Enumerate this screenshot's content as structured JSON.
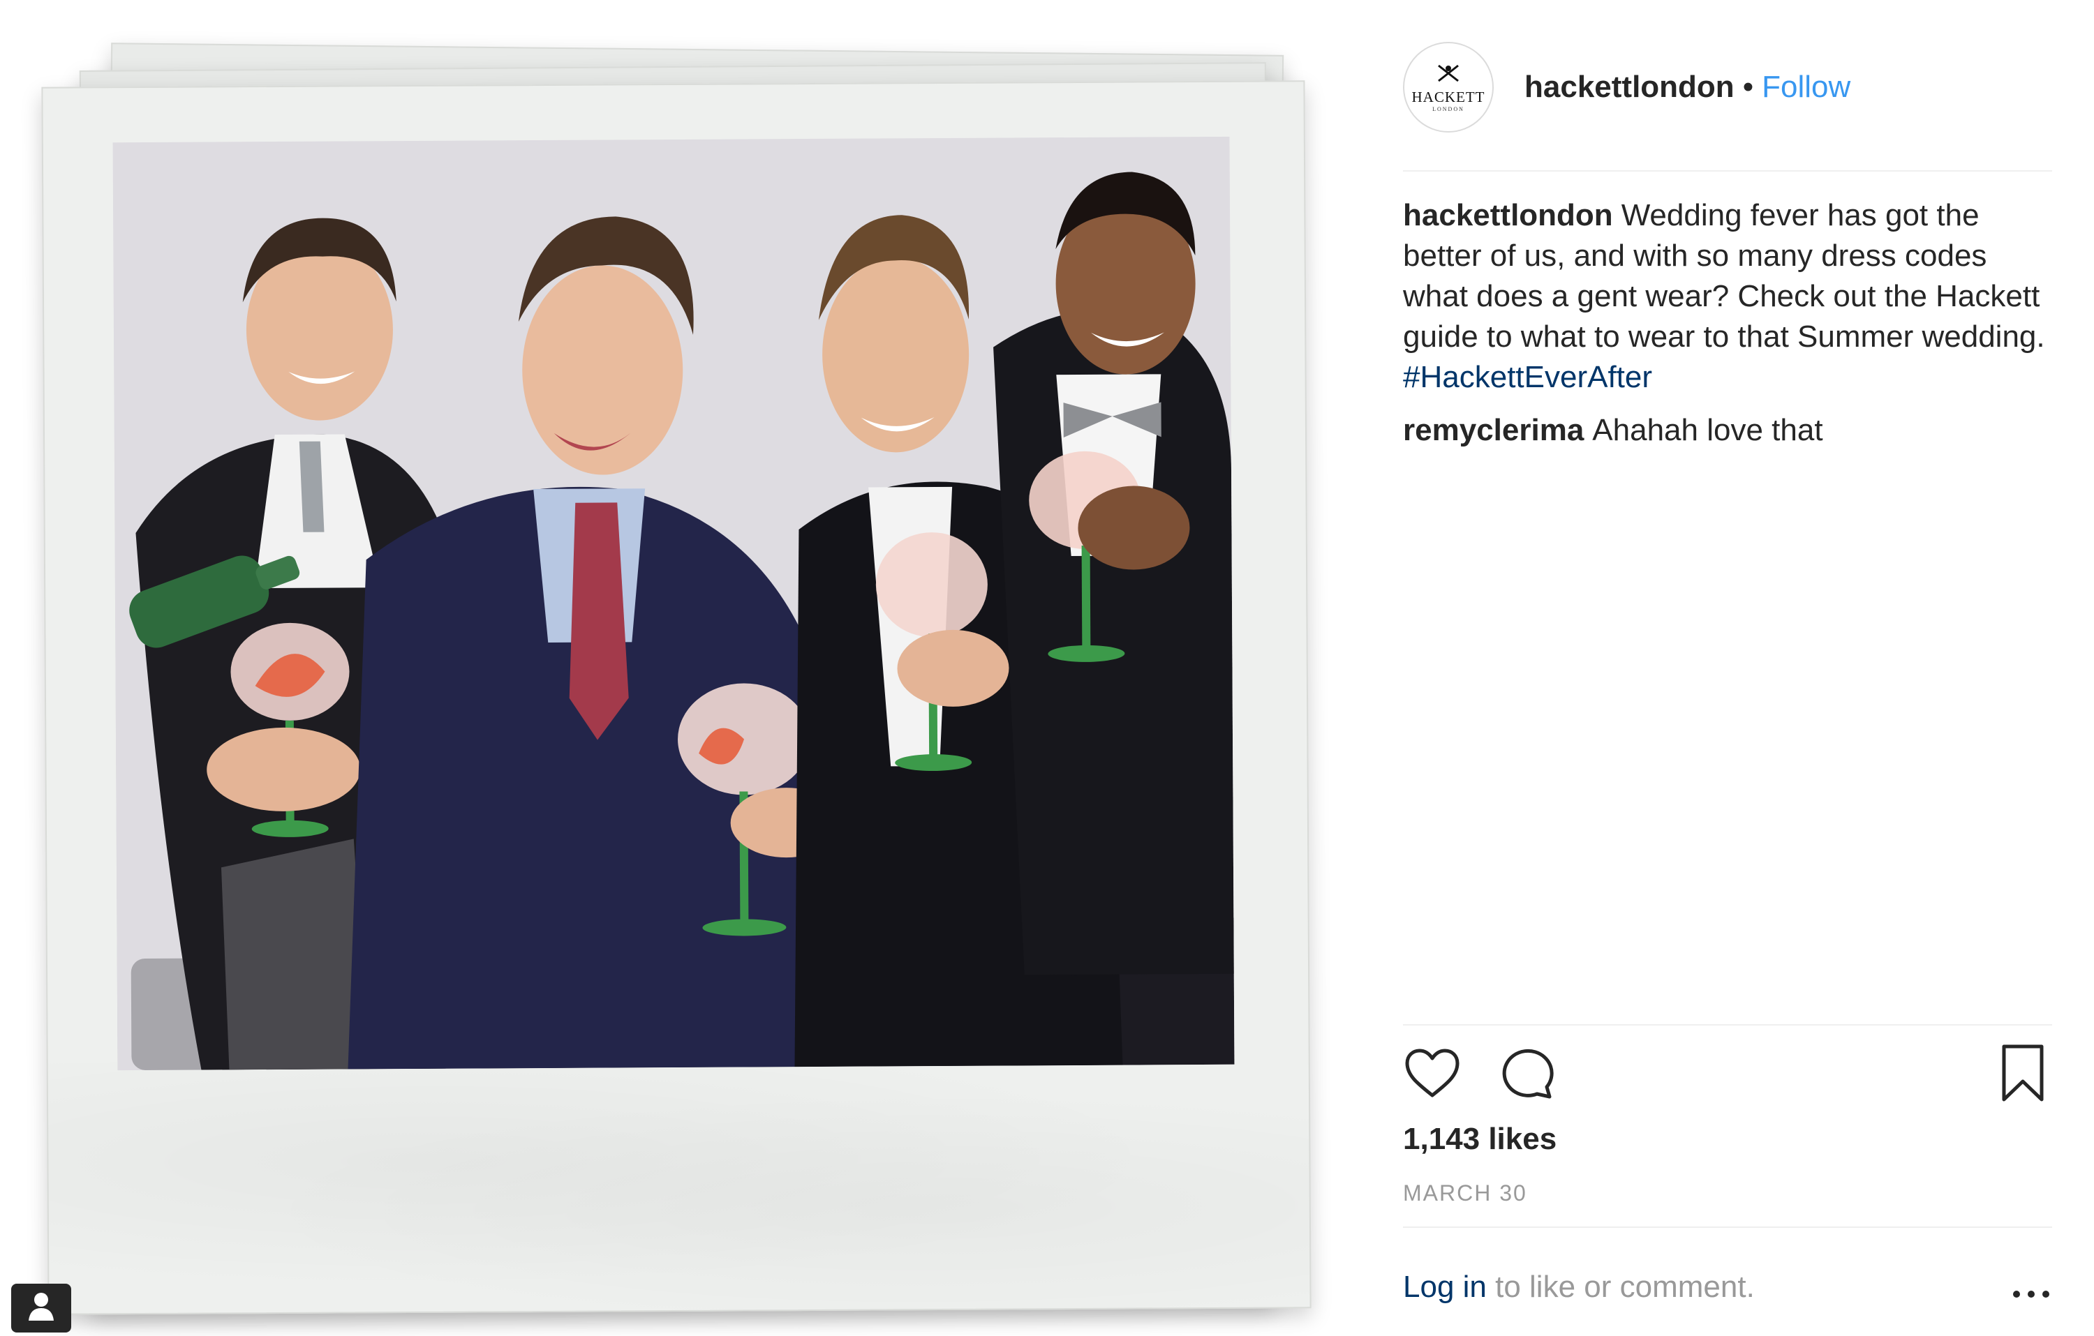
{
  "post": {
    "account": {
      "username": "hackettlondon",
      "separator": "•",
      "follow_label": "Follow",
      "avatar_logo_word": "HACKETT",
      "avatar_logo_sub": "LONDON"
    },
    "comments": [
      {
        "username": "hackettlondon",
        "text": "Wedding fever has got the better of us, and with so many dress codes what does a gent wear? Check out the Hackett guide to what to wear to that Summer wedding.",
        "hashtag": "#HackettEverAfter"
      },
      {
        "username": "remyclerima",
        "text": "Ahahah love that"
      }
    ],
    "likes_text": "1,143 likes",
    "date_text": "MARCH 30",
    "login": {
      "link_label": "Log in",
      "rest_text": " to like or comment."
    },
    "icons": {
      "like": "heart-icon",
      "comment": "speech-bubble-icon",
      "save": "bookmark-icon",
      "more": "more-dots-icon",
      "user_tag": "person-icon"
    },
    "colors": {
      "link_blue": "#3897f0",
      "hashtag_blue": "#003569",
      "text": "#262626",
      "muted": "#999999"
    }
  }
}
